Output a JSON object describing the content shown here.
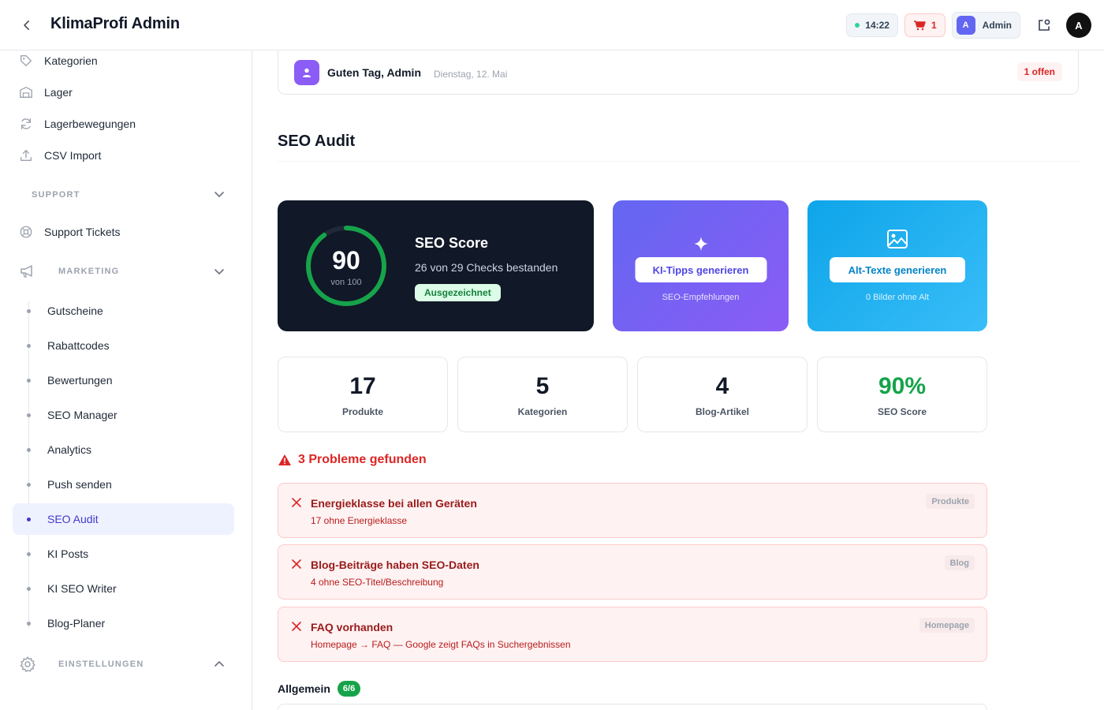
{
  "header": {
    "title": "KlimaProfi Admin",
    "time": "14:22",
    "cart_count": "1",
    "admin_initial": "A",
    "admin_label": "Admin",
    "user_initial": "A"
  },
  "sidebar": {
    "items": [
      {
        "label": "Kategorien",
        "icon": "tag-icon"
      },
      {
        "label": "Lager",
        "icon": "warehouse-icon"
      },
      {
        "label": "Lagerbewegungen",
        "icon": "refresh-icon"
      },
      {
        "label": "CSV Import",
        "icon": "upload-icon"
      }
    ],
    "support_section": "SUPPORT",
    "support_tickets": "Support Tickets",
    "marketing_section": "MARKETING",
    "marketing_items": [
      "Gutscheine",
      "Rabattcodes",
      "Bewertungen",
      "SEO Manager",
      "Analytics",
      "Push senden",
      "SEO Audit",
      "KI Posts",
      "KI SEO Writer",
      "Blog-Planer"
    ],
    "active_item": "SEO Audit",
    "settings_section": "EINSTELLUNGEN"
  },
  "greeting": {
    "text": "Guten Tag, Admin",
    "date": "Dienstag, 12. Mai",
    "badge": "1 offen"
  },
  "page": {
    "title": "SEO Audit"
  },
  "score": {
    "value": "90",
    "sub": "von 100",
    "fraction": 0.9,
    "title": "SEO Score",
    "desc": "26 von 29 Checks bestanden",
    "badge": "Ausgezeichnet"
  },
  "actions": {
    "ai_button": "KI-Tipps generieren",
    "ai_sub": "SEO-Empfehlungen",
    "alt_button": "Alt-Texte generieren",
    "alt_sub": "0 Bilder ohne Alt"
  },
  "stats": [
    {
      "value": "17",
      "label": "Produkte",
      "color": "#111827"
    },
    {
      "value": "5",
      "label": "Kategorien",
      "color": "#111827"
    },
    {
      "value": "4",
      "label": "Blog-Artikel",
      "color": "#111827"
    },
    {
      "value": "90%",
      "label": "SEO Score",
      "color": "#16a34a"
    }
  ],
  "problems": {
    "heading": "3 Probleme gefunden",
    "items": [
      {
        "title": "Energieklasse bei allen Geräten",
        "desc": "17 ohne Energieklasse",
        "tag": "Produkte"
      },
      {
        "title": "Blog-Beiträge haben SEO-Daten",
        "desc": "4 ohne SEO-Titel/Beschreibung",
        "tag": "Blog"
      },
      {
        "title": "FAQ vorhanden",
        "desc": "Homepage → FAQ — Google zeigt FAQs in Suchergebnissen",
        "tag": "Homepage"
      }
    ]
  },
  "general": {
    "heading": "Allgemein",
    "badge": "6/6"
  },
  "colors": {
    "accent": "#4338ca",
    "danger": "#dc2626",
    "success": "#16a34a",
    "dark_card": "#111827"
  }
}
